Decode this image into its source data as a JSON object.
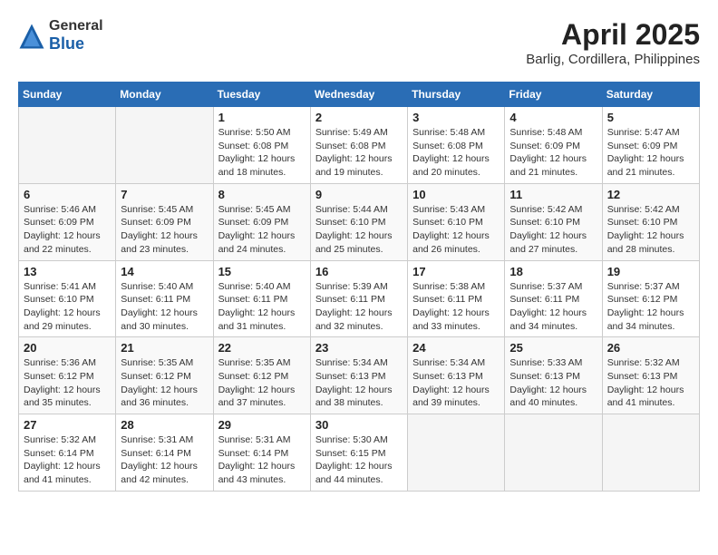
{
  "header": {
    "logo_general": "General",
    "logo_blue": "Blue",
    "month_year": "April 2025",
    "location": "Barlig, Cordillera, Philippines"
  },
  "calendar": {
    "days_of_week": [
      "Sunday",
      "Monday",
      "Tuesday",
      "Wednesday",
      "Thursday",
      "Friday",
      "Saturday"
    ],
    "weeks": [
      [
        {
          "day": "",
          "info": ""
        },
        {
          "day": "",
          "info": ""
        },
        {
          "day": "1",
          "info": "Sunrise: 5:50 AM\nSunset: 6:08 PM\nDaylight: 12 hours\nand 18 minutes."
        },
        {
          "day": "2",
          "info": "Sunrise: 5:49 AM\nSunset: 6:08 PM\nDaylight: 12 hours\nand 19 minutes."
        },
        {
          "day": "3",
          "info": "Sunrise: 5:48 AM\nSunset: 6:08 PM\nDaylight: 12 hours\nand 20 minutes."
        },
        {
          "day": "4",
          "info": "Sunrise: 5:48 AM\nSunset: 6:09 PM\nDaylight: 12 hours\nand 21 minutes."
        },
        {
          "day": "5",
          "info": "Sunrise: 5:47 AM\nSunset: 6:09 PM\nDaylight: 12 hours\nand 21 minutes."
        }
      ],
      [
        {
          "day": "6",
          "info": "Sunrise: 5:46 AM\nSunset: 6:09 PM\nDaylight: 12 hours\nand 22 minutes."
        },
        {
          "day": "7",
          "info": "Sunrise: 5:45 AM\nSunset: 6:09 PM\nDaylight: 12 hours\nand 23 minutes."
        },
        {
          "day": "8",
          "info": "Sunrise: 5:45 AM\nSunset: 6:09 PM\nDaylight: 12 hours\nand 24 minutes."
        },
        {
          "day": "9",
          "info": "Sunrise: 5:44 AM\nSunset: 6:10 PM\nDaylight: 12 hours\nand 25 minutes."
        },
        {
          "day": "10",
          "info": "Sunrise: 5:43 AM\nSunset: 6:10 PM\nDaylight: 12 hours\nand 26 minutes."
        },
        {
          "day": "11",
          "info": "Sunrise: 5:42 AM\nSunset: 6:10 PM\nDaylight: 12 hours\nand 27 minutes."
        },
        {
          "day": "12",
          "info": "Sunrise: 5:42 AM\nSunset: 6:10 PM\nDaylight: 12 hours\nand 28 minutes."
        }
      ],
      [
        {
          "day": "13",
          "info": "Sunrise: 5:41 AM\nSunset: 6:10 PM\nDaylight: 12 hours\nand 29 minutes."
        },
        {
          "day": "14",
          "info": "Sunrise: 5:40 AM\nSunset: 6:11 PM\nDaylight: 12 hours\nand 30 minutes."
        },
        {
          "day": "15",
          "info": "Sunrise: 5:40 AM\nSunset: 6:11 PM\nDaylight: 12 hours\nand 31 minutes."
        },
        {
          "day": "16",
          "info": "Sunrise: 5:39 AM\nSunset: 6:11 PM\nDaylight: 12 hours\nand 32 minutes."
        },
        {
          "day": "17",
          "info": "Sunrise: 5:38 AM\nSunset: 6:11 PM\nDaylight: 12 hours\nand 33 minutes."
        },
        {
          "day": "18",
          "info": "Sunrise: 5:37 AM\nSunset: 6:11 PM\nDaylight: 12 hours\nand 34 minutes."
        },
        {
          "day": "19",
          "info": "Sunrise: 5:37 AM\nSunset: 6:12 PM\nDaylight: 12 hours\nand 34 minutes."
        }
      ],
      [
        {
          "day": "20",
          "info": "Sunrise: 5:36 AM\nSunset: 6:12 PM\nDaylight: 12 hours\nand 35 minutes."
        },
        {
          "day": "21",
          "info": "Sunrise: 5:35 AM\nSunset: 6:12 PM\nDaylight: 12 hours\nand 36 minutes."
        },
        {
          "day": "22",
          "info": "Sunrise: 5:35 AM\nSunset: 6:12 PM\nDaylight: 12 hours\nand 37 minutes."
        },
        {
          "day": "23",
          "info": "Sunrise: 5:34 AM\nSunset: 6:13 PM\nDaylight: 12 hours\nand 38 minutes."
        },
        {
          "day": "24",
          "info": "Sunrise: 5:34 AM\nSunset: 6:13 PM\nDaylight: 12 hours\nand 39 minutes."
        },
        {
          "day": "25",
          "info": "Sunrise: 5:33 AM\nSunset: 6:13 PM\nDaylight: 12 hours\nand 40 minutes."
        },
        {
          "day": "26",
          "info": "Sunrise: 5:32 AM\nSunset: 6:13 PM\nDaylight: 12 hours\nand 41 minutes."
        }
      ],
      [
        {
          "day": "27",
          "info": "Sunrise: 5:32 AM\nSunset: 6:14 PM\nDaylight: 12 hours\nand 41 minutes."
        },
        {
          "day": "28",
          "info": "Sunrise: 5:31 AM\nSunset: 6:14 PM\nDaylight: 12 hours\nand 42 minutes."
        },
        {
          "day": "29",
          "info": "Sunrise: 5:31 AM\nSunset: 6:14 PM\nDaylight: 12 hours\nand 43 minutes."
        },
        {
          "day": "30",
          "info": "Sunrise: 5:30 AM\nSunset: 6:15 PM\nDaylight: 12 hours\nand 44 minutes."
        },
        {
          "day": "",
          "info": ""
        },
        {
          "day": "",
          "info": ""
        },
        {
          "day": "",
          "info": ""
        }
      ]
    ]
  }
}
